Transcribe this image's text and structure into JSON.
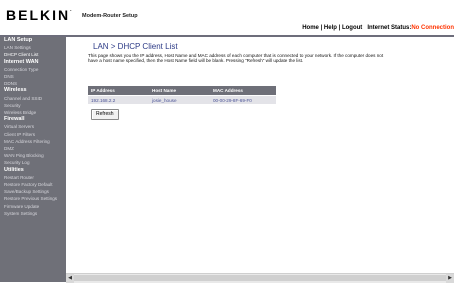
{
  "header": {
    "logo": "BELKIN",
    "logo_tm": ".",
    "app_title": "Modem-Router Setup",
    "links": {
      "home": "Home",
      "help": "Help",
      "logout": "Logout",
      "sep": "|"
    },
    "status_label": "Internet Status:",
    "status_value": "No Connection",
    "status_color": "#ff3300"
  },
  "sidebar": {
    "sections": [
      {
        "title": "LAN Setup",
        "items": [
          "LAN Settings",
          "DHCP Client List"
        ]
      },
      {
        "title": "Internet WAN",
        "items": [
          "Connection Type",
          "DNS",
          "DDNS"
        ]
      },
      {
        "title": "Wireless",
        "items": [
          "Channel and SSID",
          "Security",
          "Wireless Bridge"
        ]
      },
      {
        "title": "Firewall",
        "items": [
          "Virtual Servers",
          "Client IP Filters",
          "MAC Address Filtering",
          "DMZ",
          "WAN Ping Blocking",
          "Security Log"
        ]
      },
      {
        "title": "Utilities",
        "items": [
          "Restart Router",
          "Restore Factory Default",
          "Save/Backup Settings",
          "Restore Previous Settings",
          "Firmware Update",
          "System Settings"
        ]
      }
    ],
    "active_item": "DHCP Client List"
  },
  "main": {
    "title": "LAN > DHCP Client List",
    "description": "This page shows you the IP address, Host Name and MAC address of each computer that is connected to your network. If the computer does not have a host name specified, then the Host Name field will be blank. Pressing \"Refresh\" will update the list.",
    "table": {
      "headers": [
        "IP Address",
        "Host Name",
        "MAC Address"
      ],
      "rows": [
        [
          "192.168.2.2",
          "josie_house",
          "00-00-29-8F-69-F0"
        ]
      ]
    },
    "refresh_label": "Refresh"
  },
  "scrollbar": {
    "left_arrow": "◀",
    "right_arrow": "▶"
  },
  "colors": {
    "sidebar_bg": "#6f7078",
    "title_blue": "#2c3a86",
    "table_header": "#6e6f78"
  }
}
